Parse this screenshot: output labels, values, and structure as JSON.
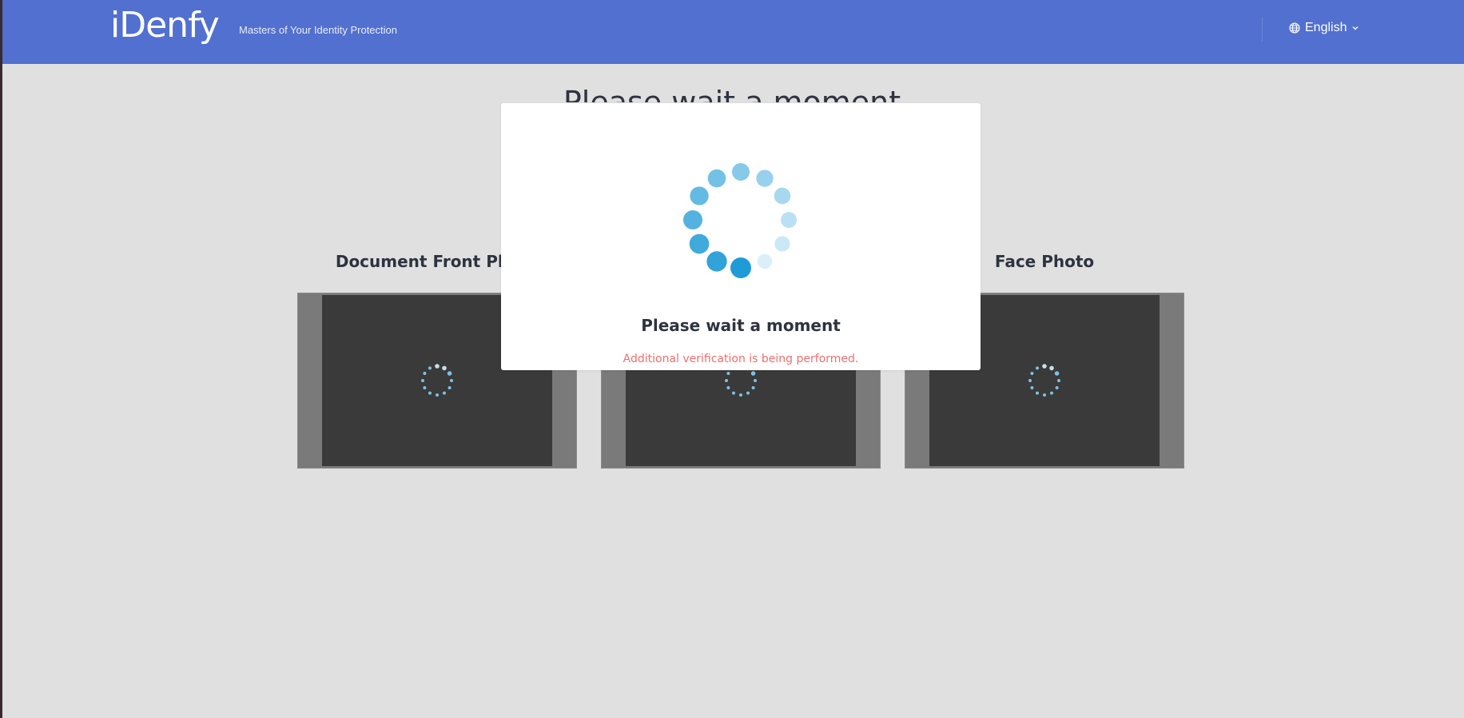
{
  "header": {
    "logo_text": "iDenfy",
    "tagline": "Masters of Your Identity Protection",
    "language": {
      "label": "English",
      "icon": "globe-icon",
      "chevron_icon": "chevron-down-icon"
    },
    "colors": {
      "background": "#5270cf",
      "text": "#ffffff"
    }
  },
  "main": {
    "title": "Please wait a moment",
    "cards": [
      {
        "title": "Document Front Photo",
        "icon": "loading-spinner-icon"
      },
      {
        "title": "",
        "icon": "loading-spinner-icon"
      },
      {
        "title": "Face Photo",
        "icon": "loading-spinner-icon"
      }
    ]
  },
  "modal": {
    "icon": "loading-spinner-icon",
    "title": "Please wait a moment",
    "message": "Additional verification is being performed.",
    "colors": {
      "spinner": "#1f9bd7",
      "message": "#f06e6e"
    }
  }
}
